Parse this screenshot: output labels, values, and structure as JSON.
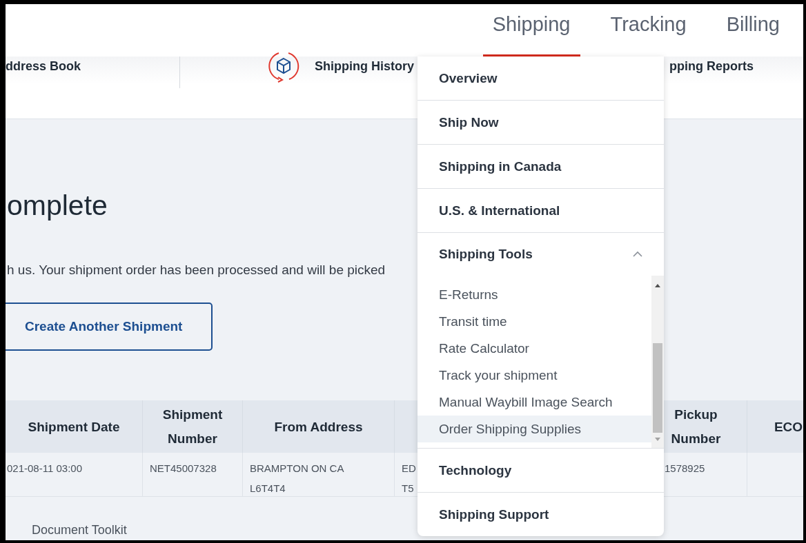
{
  "top_nav": {
    "tabs": [
      {
        "label": "Shipping",
        "selected": true
      },
      {
        "label": "Tracking",
        "selected": false
      },
      {
        "label": "Billing",
        "selected": false
      }
    ]
  },
  "sub_nav": {
    "items": [
      {
        "label": "ddress Book",
        "icon": false
      },
      {
        "label": "Shipping History",
        "icon": true
      },
      {
        "label": "pping Reports",
        "icon": false
      }
    ]
  },
  "page": {
    "title": "omplete",
    "message": "h us. Your shipment order has been processed and will be picked",
    "button": "Create Another Shipment"
  },
  "table": {
    "columns": [
      "Shipment Date",
      "Shipment Number",
      "From Address",
      "",
      "Pickup Number",
      "ECO"
    ],
    "rows": [
      {
        "cells": [
          "021-08-11 03:00",
          "NET45007328",
          "BRAMPTON ON CA\nL6T4T4",
          "ED\nT5",
          "1578925",
          ""
        ]
      }
    ]
  },
  "footer_link": "Document Toolkit",
  "dropdown": {
    "items": [
      {
        "kind": "link",
        "label": "Overview"
      },
      {
        "kind": "link",
        "label": "Ship Now"
      },
      {
        "kind": "link",
        "label": "Shipping in Canada"
      },
      {
        "kind": "link",
        "label": "U.S. & International"
      },
      {
        "kind": "group",
        "label": "Shipping Tools",
        "expanded": true,
        "children": [
          {
            "label": "E-Returns",
            "selected": false
          },
          {
            "label": "Transit time",
            "selected": false
          },
          {
            "label": "Rate Calculator",
            "selected": false
          },
          {
            "label": "Track your shipment",
            "selected": false
          },
          {
            "label": "Manual Waybill Image Search",
            "selected": false
          },
          {
            "label": "Order Shipping Supplies",
            "selected": true
          }
        ]
      },
      {
        "kind": "link",
        "label": "Technology"
      },
      {
        "kind": "link",
        "label": "Shipping Support"
      }
    ]
  }
}
